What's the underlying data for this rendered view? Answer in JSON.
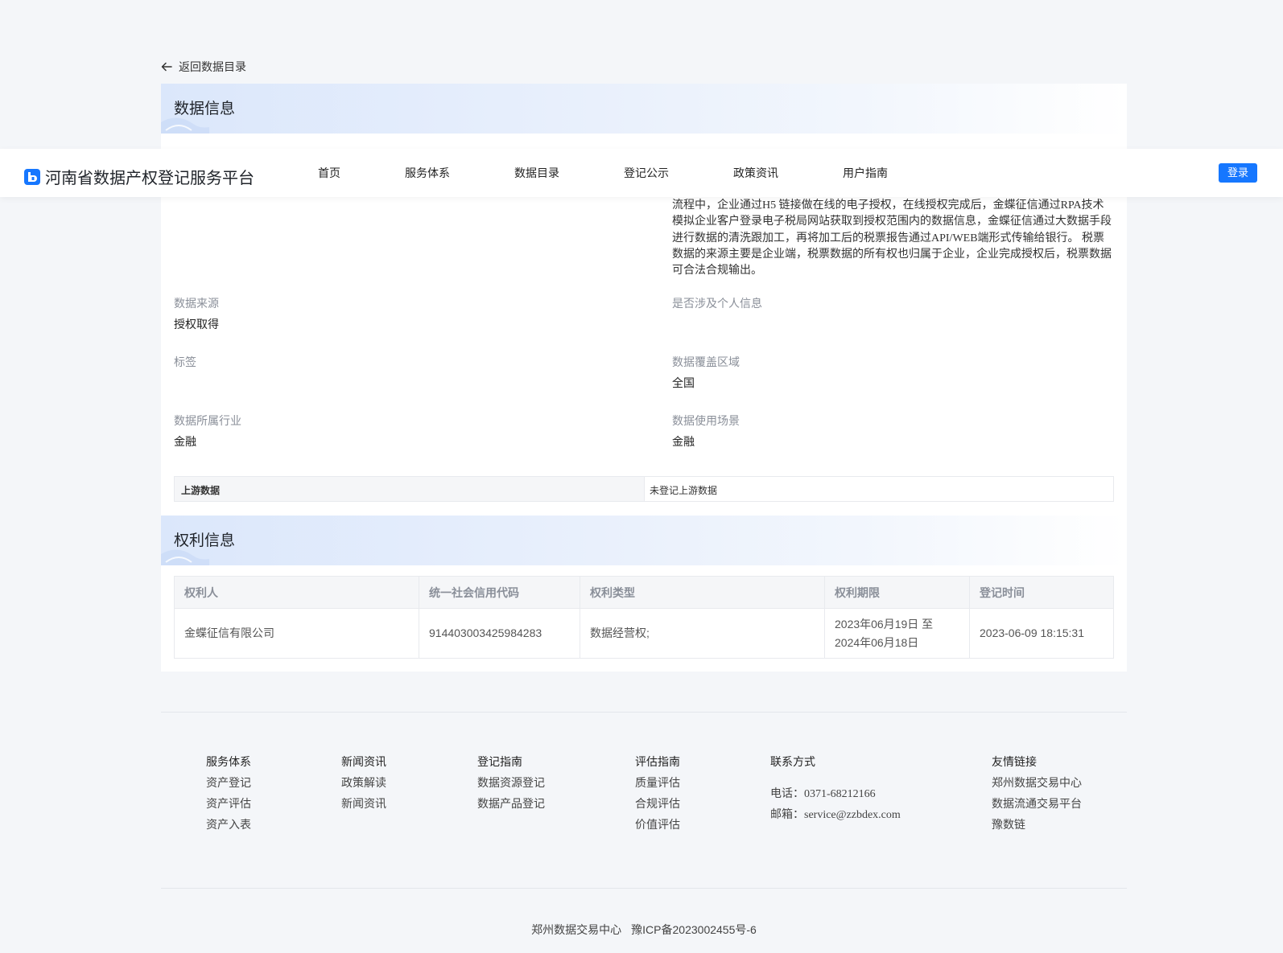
{
  "back": {
    "label": "返回数据目录"
  },
  "sections": {
    "data_info": "数据信息",
    "rights_info": "权利信息"
  },
  "description_lines": [
    "流程中，企业通过H5 链接做在线的电子授权，在线授权完成后，金蝶征信通过RPA技术",
    "模拟企业客户登录电子税局网站获取到授权范围内的数据信息，金蝶征信通过大数据手段",
    "进行数据的清洗跟加工，再将加工后的税票报告通过API/WEB端形式传输给银行。 税票",
    "数据的来源主要是企业端，税票数据的所有权也归属于企业，企业完成授权后，税票数据",
    "可合法合规输出。"
  ],
  "fields": {
    "data_source": {
      "label": "数据来源",
      "value": "授权取得"
    },
    "personal_info": {
      "label": "是否涉及个人信息",
      "value": ""
    },
    "tags": {
      "label": "标签",
      "value": ""
    },
    "coverage": {
      "label": "数据覆盖区域",
      "value": "全国"
    },
    "industry": {
      "label": "数据所属行业",
      "value": "金融"
    },
    "scenario": {
      "label": "数据使用场景",
      "value": "金融"
    }
  },
  "upstream": {
    "label": "上游数据",
    "value": "未登记上游数据"
  },
  "rights_table": {
    "headers": [
      "权利人",
      "统一社会信用代码",
      "权利类型",
      "权利期限",
      "登记时间"
    ],
    "row": {
      "holder": "金蝶征信有限公司",
      "credit_code": "914403003425984283",
      "right_type": "数据经营权;",
      "period_line1": "2023年06月19日 至",
      "period_line2": "2024年06月18日",
      "registered_at": "2023-06-09 18:15:31"
    }
  },
  "nav": {
    "site_title": "河南省数据产权登记服务平台",
    "items": [
      "首页",
      "服务体系",
      "数据目录",
      "登记公示",
      "政策资讯",
      "用户指南"
    ],
    "login": "登录"
  },
  "footer": {
    "service": {
      "title": "服务体系",
      "items": [
        "资产登记",
        "资产评估",
        "资产入表"
      ]
    },
    "news": {
      "title": "新闻资讯",
      "items": [
        "政策解读",
        "新闻资讯"
      ]
    },
    "register": {
      "title": "登记指南",
      "items": [
        "数据资源登记",
        "数据产品登记"
      ]
    },
    "evaluate": {
      "title": "评估指南",
      "items": [
        "质量评估",
        "合规评估",
        "价值评估"
      ]
    },
    "contact": {
      "title": "联系方式",
      "phone_label": "电话：",
      "phone": "0371-68212166",
      "email_label": "邮箱：",
      "email": "service@zzbdex.com"
    },
    "links": {
      "title": "友情链接",
      "items": [
        "郑州数据交易中心",
        "数据流通交易平台",
        "豫数链"
      ]
    },
    "org": "郑州数据交易中心",
    "icp": "豫ICP备2023002455号-6"
  },
  "colors": {
    "primary": "#1677ff",
    "page_bg": "#f4f6f9",
    "header_gradient": "#dbe7fb"
  }
}
